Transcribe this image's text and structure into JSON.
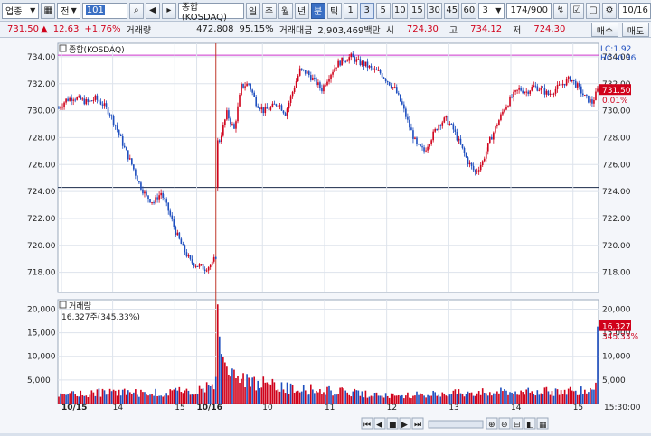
{
  "toolbar": {
    "market_select": "업종",
    "type_select": "전",
    "code_input": "101",
    "name_box": "종합(KOSDAQ)",
    "periods": [
      "일",
      "주",
      "월",
      "년",
      "분",
      "틱"
    ],
    "active_period": "분",
    "intervals": [
      "1",
      "3",
      "5",
      "10",
      "15",
      "30",
      "45",
      "60"
    ],
    "selected_interval": "3",
    "interval_select": "3",
    "page_counter": "174/900",
    "date": "10/16"
  },
  "quote": {
    "price": "731.50",
    "change": "12.63",
    "change_pct": "+1.76%",
    "volume_label": "거래량",
    "volume": "472,808",
    "ratio": "95.15%",
    "amount_label": "거래대금",
    "amount": "2,903,469백만",
    "open_label": "시",
    "open": "724.30",
    "high_label": "고",
    "high": "734.12",
    "low_label": "저",
    "low": "724.30"
  },
  "side_buttons": {
    "buy": "매수",
    "sell": "매도"
  },
  "colors": {
    "up": "#d0021b",
    "down": "#1f4fbf",
    "grid": "#dde3ec",
    "hline": "#cc33cc"
  },
  "chart_data": [
    {
      "type": "candlestick",
      "title": "종합(KOSDAQ)",
      "indicators": [
        "LC:1.92",
        "HC:-0.36"
      ],
      "price_label": "731.50",
      "price_pct": "0.01%",
      "ylim": [
        716.5,
        735
      ],
      "yticks": [
        718,
        720,
        722,
        724,
        726,
        728,
        730,
        732,
        734
      ],
      "ytick_labels": [
        "718.00",
        "720.00",
        "722.00",
        "724.00",
        "726.00",
        "728.00",
        "730.00",
        "732.00",
        "734.00"
      ],
      "ref_lines": [
        724.3,
        734.12
      ],
      "x_labels": [
        {
          "label": "10/15",
          "bar": 2
        },
        {
          "label": "14",
          "bar": 30
        },
        {
          "label": "15",
          "bar": 64
        },
        {
          "label": "10/16",
          "bar": 76
        },
        {
          "label": "10",
          "bar": 112
        },
        {
          "label": "11",
          "bar": 146
        },
        {
          "label": "12",
          "bar": 180
        },
        {
          "label": "13",
          "bar": 214
        },
        {
          "label": "14",
          "bar": 248
        },
        {
          "label": "15",
          "bar": 282
        }
      ],
      "bars": 296,
      "close_path": [
        [
          0,
          730.2
        ],
        [
          4,
          730.8
        ],
        [
          8,
          731.0
        ],
        [
          12,
          730.8
        ],
        [
          16,
          730.6
        ],
        [
          20,
          730.9
        ],
        [
          24,
          730.5
        ],
        [
          28,
          729.8
        ],
        [
          32,
          728.6
        ],
        [
          36,
          727.2
        ],
        [
          40,
          726.0
        ],
        [
          44,
          724.6
        ],
        [
          48,
          723.6
        ],
        [
          52,
          723.2
        ],
        [
          56,
          723.9
        ],
        [
          60,
          722.6
        ],
        [
          64,
          721.0
        ],
        [
          68,
          719.8
        ],
        [
          72,
          718.8
        ],
        [
          76,
          718.5
        ],
        [
          80,
          718.3
        ],
        [
          84,
          718.6
        ],
        [
          86,
          719.2
        ],
        [
          88,
          727.8
        ],
        [
          92,
          729.8
        ],
        [
          96,
          728.6
        ],
        [
          100,
          731.8
        ],
        [
          104,
          732.0
        ],
        [
          108,
          730.6
        ],
        [
          112,
          730.0
        ],
        [
          116,
          730.2
        ],
        [
          120,
          730.6
        ],
        [
          124,
          729.8
        ],
        [
          128,
          731.4
        ],
        [
          132,
          733.0
        ],
        [
          136,
          732.8
        ],
        [
          140,
          732.2
        ],
        [
          144,
          731.6
        ],
        [
          148,
          732.6
        ],
        [
          152,
          733.4
        ],
        [
          156,
          733.8
        ],
        [
          160,
          734.0
        ],
        [
          164,
          733.6
        ],
        [
          168,
          733.4
        ],
        [
          172,
          733.0
        ],
        [
          176,
          732.8
        ],
        [
          180,
          732.2
        ],
        [
          184,
          731.6
        ],
        [
          188,
          730.4
        ],
        [
          192,
          728.8
        ],
        [
          196,
          727.4
        ],
        [
          200,
          727.0
        ],
        [
          204,
          728.0
        ],
        [
          208,
          729.0
        ],
        [
          212,
          729.4
        ],
        [
          216,
          728.6
        ],
        [
          220,
          727.4
        ],
        [
          224,
          726.2
        ],
        [
          228,
          725.4
        ],
        [
          232,
          726.2
        ],
        [
          236,
          727.8
        ],
        [
          240,
          729.0
        ],
        [
          244,
          730.2
        ],
        [
          248,
          731.0
        ],
        [
          252,
          731.6
        ],
        [
          256,
          731.4
        ],
        [
          260,
          731.8
        ],
        [
          264,
          731.6
        ],
        [
          268,
          731.2
        ],
        [
          272,
          731.6
        ],
        [
          276,
          732.0
        ],
        [
          280,
          732.4
        ],
        [
          284,
          731.8
        ],
        [
          288,
          731.0
        ],
        [
          292,
          730.6
        ],
        [
          295,
          731.5
        ]
      ]
    },
    {
      "type": "bar",
      "title": "거래량",
      "value_label": "16,327주(345.33%)",
      "last_label": "16,327",
      "last_pct": "345.33%",
      "ylim": [
        0,
        22000
      ],
      "yticks": [
        5000,
        10000,
        15000,
        20000
      ],
      "ytick_labels": [
        "5,000",
        "10,000",
        "15,000",
        "20,000"
      ],
      "spikes": [
        {
          "bar": 87,
          "value": 21000
        },
        {
          "bar": 88,
          "value": 14200
        },
        {
          "bar": 89,
          "value": 10500
        },
        {
          "bar": 90,
          "value": 9800
        },
        {
          "bar": 91,
          "value": 8700
        },
        {
          "bar": 92,
          "value": 7800
        },
        {
          "bar": 295,
          "value": 16327
        }
      ],
      "base_profile": [
        [
          0,
          2000
        ],
        [
          30,
          2400
        ],
        [
          60,
          2200
        ],
        [
          80,
          3200
        ],
        [
          86,
          4200
        ],
        [
          95,
          6000
        ],
        [
          110,
          4200
        ],
        [
          130,
          3200
        ],
        [
          150,
          2600
        ],
        [
          170,
          2000
        ],
        [
          190,
          1800
        ],
        [
          210,
          2100
        ],
        [
          230,
          2300
        ],
        [
          250,
          2600
        ],
        [
          270,
          2500
        ],
        [
          290,
          3000
        ],
        [
          294,
          4000
        ]
      ],
      "time": "15:30:00"
    }
  ]
}
